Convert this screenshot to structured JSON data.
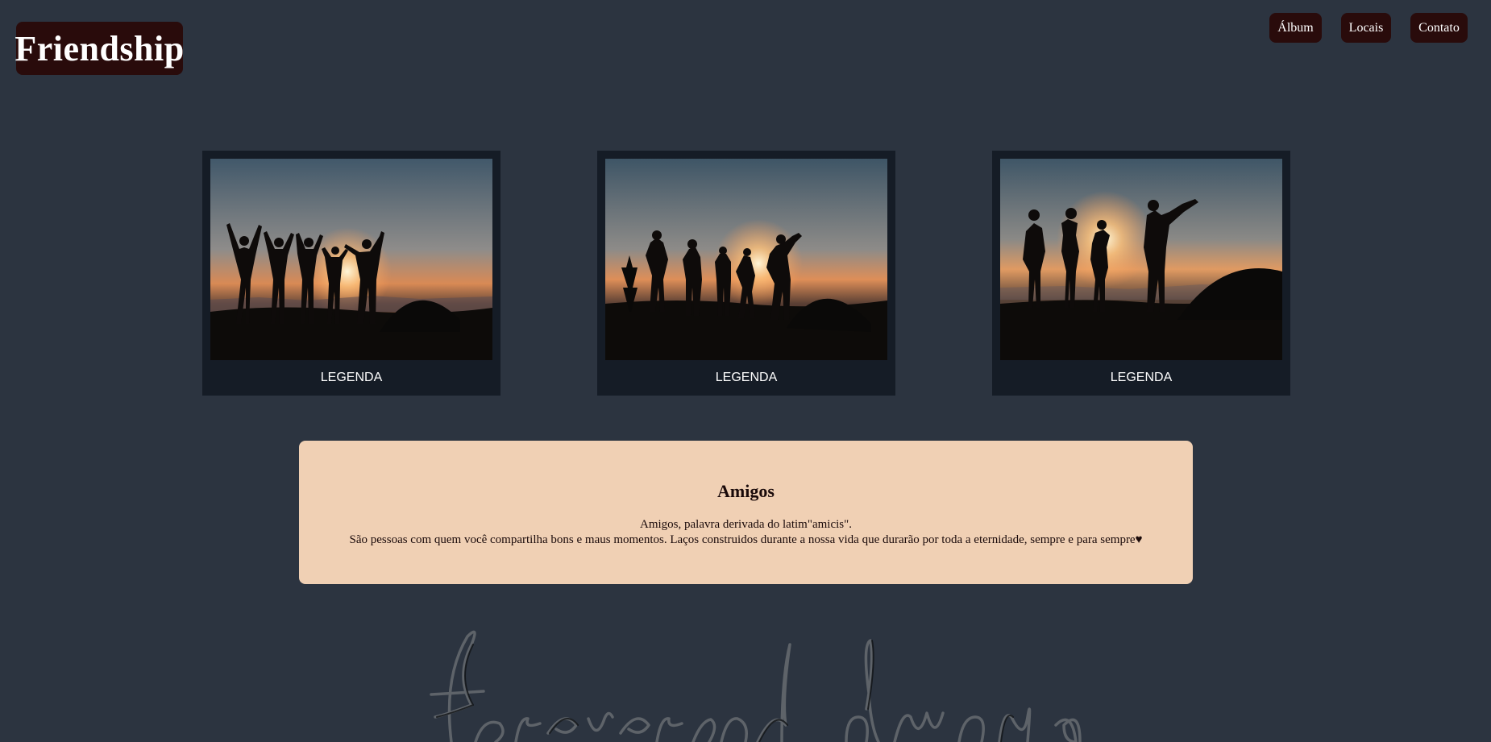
{
  "header": {
    "logo_text": "Friendship",
    "nav": [
      {
        "label": "Álbum"
      },
      {
        "label": "Locais"
      },
      {
        "label": "Contato"
      }
    ]
  },
  "gallery": {
    "cards": [
      {
        "caption": "LEGENDA",
        "image": "friends-silhouette-sunset-tent"
      },
      {
        "caption": "LEGENDA",
        "image": "friends-silhouette-sunset-tent"
      },
      {
        "caption": "LEGENDA",
        "image": "friends-silhouette-sunset-tent"
      }
    ]
  },
  "about": {
    "title": "Amigos",
    "line1": "Amigos, palavra derivada do latim\"amicis\".",
    "line2": "São pessoas com quem você compartilha bons e maus momentos. Laços construidos durante a nossa vida que durarão por toda a eternidade, sempre e para sempre♥"
  },
  "decorative_script": {
    "image": "handwritten-forever-and-always"
  },
  "colors": {
    "background": "#2c3440",
    "header_button": "#290b0b",
    "card": "#151c26",
    "about_panel": "#f0d0b4"
  }
}
